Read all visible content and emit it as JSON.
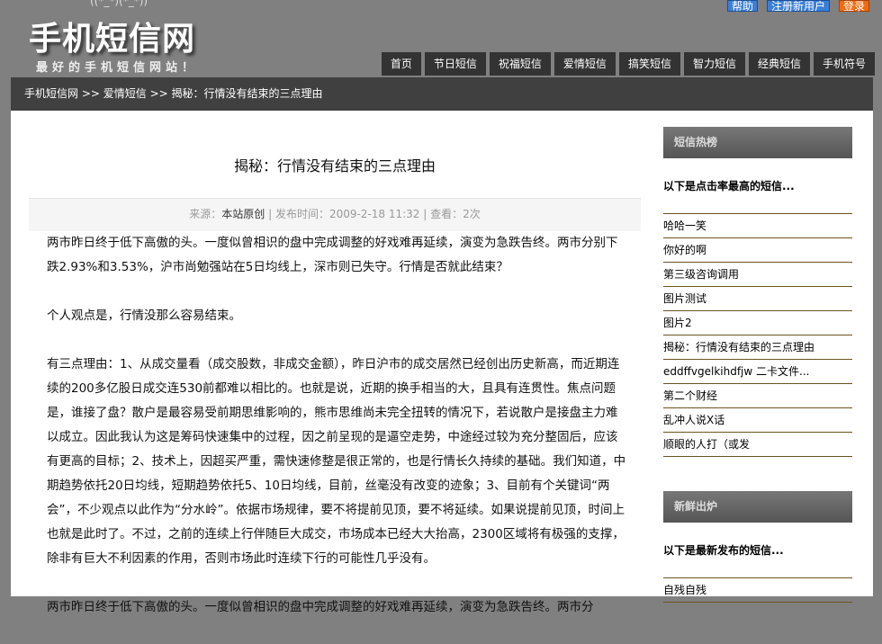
{
  "header": {
    "emoticon": "((*_*)(*_*))",
    "logo": "手机短信网",
    "slogan": "最好的手机短信网站！",
    "help": "帮助",
    "register": "注册新用户",
    "login": "登录"
  },
  "nav": [
    "首页",
    "节日短信",
    "祝福短信",
    "爱情短信",
    "搞笑短信",
    "智力短信",
    "经典短信",
    "手机符号"
  ],
  "breadcrumb": {
    "home": "手机短信网",
    "sep1": " >> ",
    "category": "爱情短信",
    "sep2": " >> ",
    "current": "揭秘：行情没有结束的三点理由"
  },
  "article": {
    "title": "揭秘：行情没有结束的三点理由",
    "meta": {
      "source_label": "来源：",
      "source": "本站原创",
      "date_label": " | 发布时间：2009-2-18 11:32 | ",
      "views": "查看：2次"
    },
    "paragraphs": [
      "两市昨日终于低下高傲的头。一度似曾相识的盘中完成调整的好戏难再延续，演变为急跌告终。两市分别下跌2.93%和3.53%，沪市尚勉强站在5日均线上，深市则已失守。行情是否就此结束？",
      "个人观点是，行情没那么容易结束。",
      "有三点理由：1、从成交量看（成交股数，非成交金额），昨日沪市的成交居然已经创出历史新高，而近期连续的200多亿股日成交连530前都难以相比的。也就是说，近期的换手相当的大，且具有连贯性。焦点问题是，谁接了盘？散户是最容易受前期思维影响的，熊市思维尚未完全扭转的情况下，若说散户是接盘主力难以成立。因此我认为这是筹码快速集中的过程，因之前呈现的是逼空走势，中途经过较为充分整固后，应该有更高的目标；2、技术上，因超买严重，需快速修整是很正常的，也是行情长久持续的基础。我们知道，中期趋势依托20日均线，短期趋势依托5、10日均线，目前，丝毫没有改变的迹象；3、目前有个关键词“两会”，不少观点以此作为“分水岭”。依据市场规律，要不将提前见顶，要不将延续。如果说提前见顶，时间上也就是此时了。不过，之前的连续上行伴随巨大成交，市场成本已经大大抬高，2300区域将有极强的支撑，除非有巨大不利因素的作用，否则市场此时连续下行的可能性几乎没有。",
      "两市昨日终于低下高傲的头。一度似曾相识的盘中完成调整的好戏难再延续，演变为急跌告终。两市分"
    ]
  },
  "sidebar": {
    "hot": {
      "title": "短信热榜",
      "subtitle": "以下是点击率最高的短信...",
      "items": [
        "哈哈一笑",
        "你好的啊",
        "第三级咨询调用",
        "图片测试",
        "图片2",
        "揭秘：行情没有结束的三点理由",
        "eddffvgelkihdfjw 二卡文件...",
        "第二个财经",
        "乱冲人说X话",
        "顺眼的人打（或发"
      ]
    },
    "new": {
      "title": "新鲜出炉",
      "subtitle": "以下是最新发布的短信...",
      "items": [
        "自残自残"
      ]
    }
  }
}
